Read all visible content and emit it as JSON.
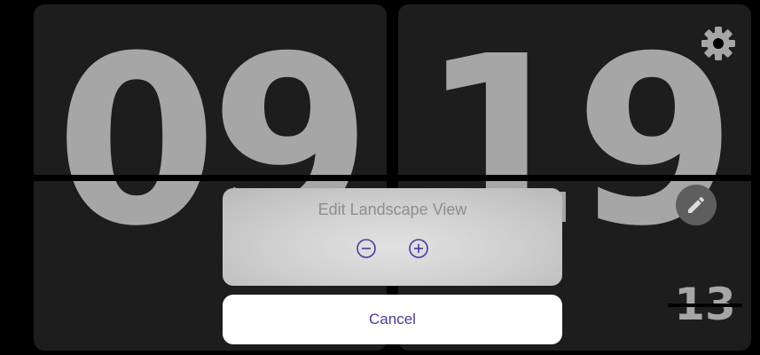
{
  "clock": {
    "hours": "09",
    "minutes": "19",
    "seconds": "13"
  },
  "icons": {
    "settings": "gear-icon",
    "edit": "pencil-icon",
    "zoom_out": "minus-circle-icon",
    "zoom_in": "plus-circle-icon"
  },
  "edit_dialog": {
    "title": "Edit Landscape View",
    "cancel_label": "Cancel"
  },
  "colors": {
    "digit": "#a6a6a6",
    "panel": "#1d1d1d",
    "accent": "#4a3aa2"
  }
}
